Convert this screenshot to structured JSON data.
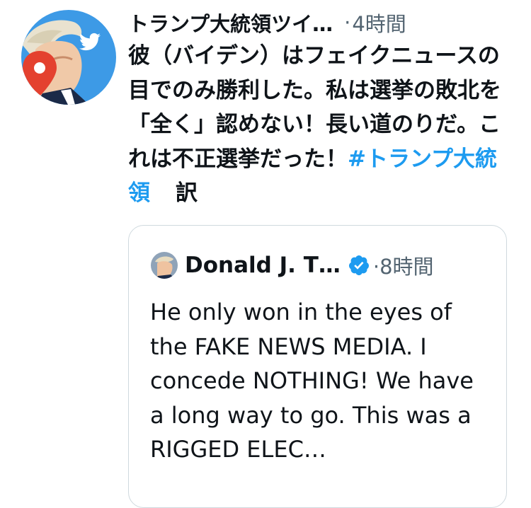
{
  "tweet": {
    "author_name": "トランプ大統領ツイ…",
    "separator": "·",
    "time": "4時間",
    "text_main": "彼（バイデン）はフェイクニュースの目でのみ勝利した。私は選挙の敗北を「全く」認めない！長い道のりだ。これは不正選挙だった！",
    "hashtag": "#トランプ大統領",
    "translate_label": "訳"
  },
  "quote": {
    "author_name": "Donald J. T…",
    "separator": "·",
    "time": "8時間",
    "text": "He only won in the eyes of the FAKE NEWS MEDIA. I concede NOTHING! We have a long way to go. This was a RIGGED ELEC…"
  },
  "icons": {
    "avatar_badge": "twitter-bird-icon",
    "location_pin": "location-pin-icon",
    "verified": "verified-badge-icon"
  },
  "colors": {
    "hashtag": "#1d9bf0",
    "verified": "#1d9bf0",
    "secondary_text": "#536471",
    "border": "#cfd9de"
  }
}
